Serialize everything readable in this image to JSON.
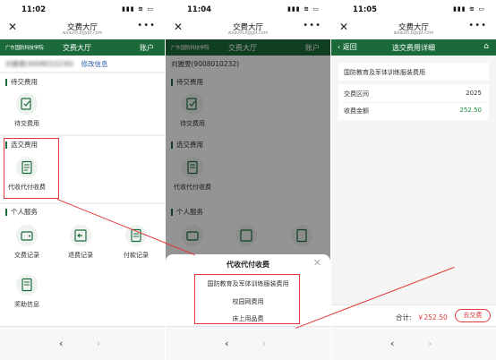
{
  "screens": [
    {
      "time": "11:02",
      "title": "交费大厅",
      "domain": "wxauth.bgypt.com",
      "school_logo": "广东国防科技学院",
      "header_name": "交费大厅",
      "account": "账户",
      "user_masked": "刘雅雯(9008010230)",
      "edit": "修改信息",
      "sec_pending": "待交费用",
      "pending_tile": "待交费用",
      "sec_optional": "选交费用",
      "optional_tile": "代收代付收费",
      "sec_personal": "个人服务",
      "tiles": [
        "交费记录",
        "退费记录",
        "付款记录",
        "奖助信息"
      ]
    },
    {
      "time": "11:04",
      "title": "交费大厅",
      "domain": "wxauth.bgypt.com",
      "school_logo": "广东国防科技学院",
      "header_name": "交费大厅",
      "account": "账户",
      "user": "刘雅雯(9008010232)",
      "sec_pending": "待交费用",
      "pending_tile": "待交费用",
      "sec_optional": "选交费用",
      "optional_tile": "代收代付收费",
      "sec_personal": "个人服务",
      "sheet_title": "代收代付收费",
      "options": [
        "国防教育及军体训练服装费用",
        "校园网费用",
        "床上用品费"
      ]
    },
    {
      "time": "11:05",
      "title": "交费大厅",
      "domain": "wxauth.bgypt.com",
      "back": "返回",
      "header_title": "选交费用详细",
      "item_name": "国防教育及军体训练服装费用",
      "label_period": "交费区间",
      "period": "2025",
      "label_amount": "收费金额",
      "amount": "252.50",
      "total_label": "合计:",
      "total": "￥252.50",
      "pay_button": "去交费"
    }
  ],
  "colors": {
    "brand_green": "#1b6b3a",
    "annotation_red": "#e03a3a"
  }
}
